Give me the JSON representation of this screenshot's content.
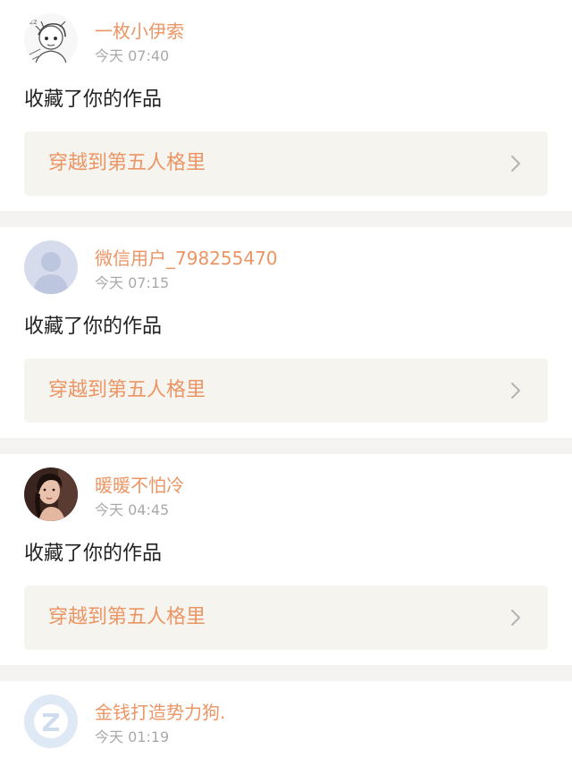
{
  "notifications": [
    {
      "username": "一枚小伊索",
      "time": "今天 07:40",
      "action": "收藏了你的作品",
      "work_title": "穿越到第五人格里",
      "avatar_icon": "sketch-avatar-icon"
    },
    {
      "username": "微信用户_798255470",
      "time": "今天 07:15",
      "action": "收藏了你的作品",
      "work_title": "穿越到第五人格里",
      "avatar_icon": "default-user-avatar-icon"
    },
    {
      "username": "暖暖不怕冷",
      "time": "今天 04:45",
      "action": "收藏了你的作品",
      "work_title": "穿越到第五人格里",
      "avatar_icon": "photo-avatar-icon"
    },
    {
      "username": "金钱打造势力狗.",
      "time": "今天 01:19",
      "avatar_icon": "qq-avatar-icon"
    }
  ],
  "colors": {
    "accent": "#ec9564",
    "time": "#a9a9a9",
    "separator": "#f5f3f2",
    "work_bg": "#f5f4ef"
  }
}
